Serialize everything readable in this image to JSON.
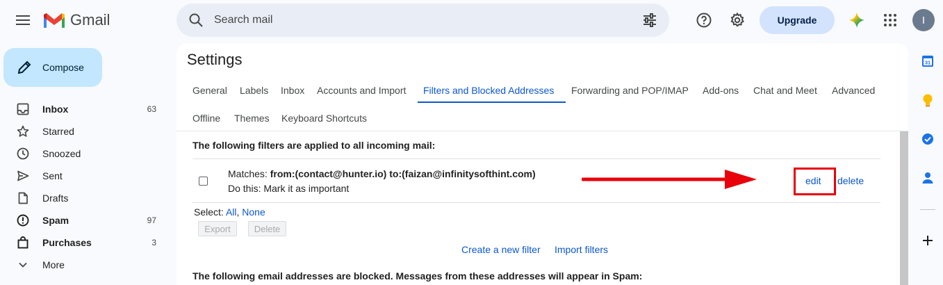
{
  "app": {
    "name": "Gmail"
  },
  "search": {
    "placeholder": "Search mail"
  },
  "header": {
    "upgrade_label": "Upgrade",
    "avatar_letter": "I"
  },
  "compose_label": "Compose",
  "sidebar": {
    "items": [
      {
        "label": "Inbox",
        "count": "63",
        "icon": "inbox-icon",
        "bold": true
      },
      {
        "label": "Starred",
        "count": "",
        "icon": "star-icon",
        "bold": false
      },
      {
        "label": "Snoozed",
        "count": "",
        "icon": "clock-icon",
        "bold": false
      },
      {
        "label": "Sent",
        "count": "",
        "icon": "send-icon",
        "bold": false
      },
      {
        "label": "Drafts",
        "count": "",
        "icon": "draft-icon",
        "bold": false
      },
      {
        "label": "Spam",
        "count": "97",
        "icon": "spam-icon",
        "bold": true
      },
      {
        "label": "Purchases",
        "count": "3",
        "icon": "shopping-bag-icon",
        "bold": true
      },
      {
        "label": "More",
        "count": "",
        "icon": "chevron-down-icon",
        "bold": false
      }
    ]
  },
  "settings": {
    "title": "Settings",
    "tabs": [
      "General",
      "Labels",
      "Inbox",
      "Accounts and Import",
      "Filters and Blocked Addresses",
      "Forwarding and POP/IMAP",
      "Add-ons",
      "Chat and Meet",
      "Advanced",
      "Offline",
      "Themes",
      "Keyboard Shortcuts"
    ],
    "active_tab": "Filters and Blocked Addresses",
    "filters_heading": "The following filters are applied to all incoming mail:",
    "filter": {
      "matches_label": "Matches:",
      "matches_value": "from:(contact@hunter.io) to:(faizan@infinitysofthint.com)",
      "action_label": "Do this:",
      "action_value": "Mark it as important",
      "edit_label": "edit",
      "delete_label": "delete"
    },
    "select_label": "Select:",
    "select_all": "All",
    "select_none": "None",
    "export_label": "Export",
    "delete_label": "Delete",
    "create_filter": "Create a new filter",
    "import_filters": "Import filters",
    "blocked_heading": "The following email addresses are blocked. Messages from these addresses will appear in Spam:"
  },
  "colors": {
    "accent": "#0b57d0",
    "annotation_red": "#e8000b",
    "compose_bg": "#c2e7ff",
    "search_bg": "#e9eef6"
  }
}
